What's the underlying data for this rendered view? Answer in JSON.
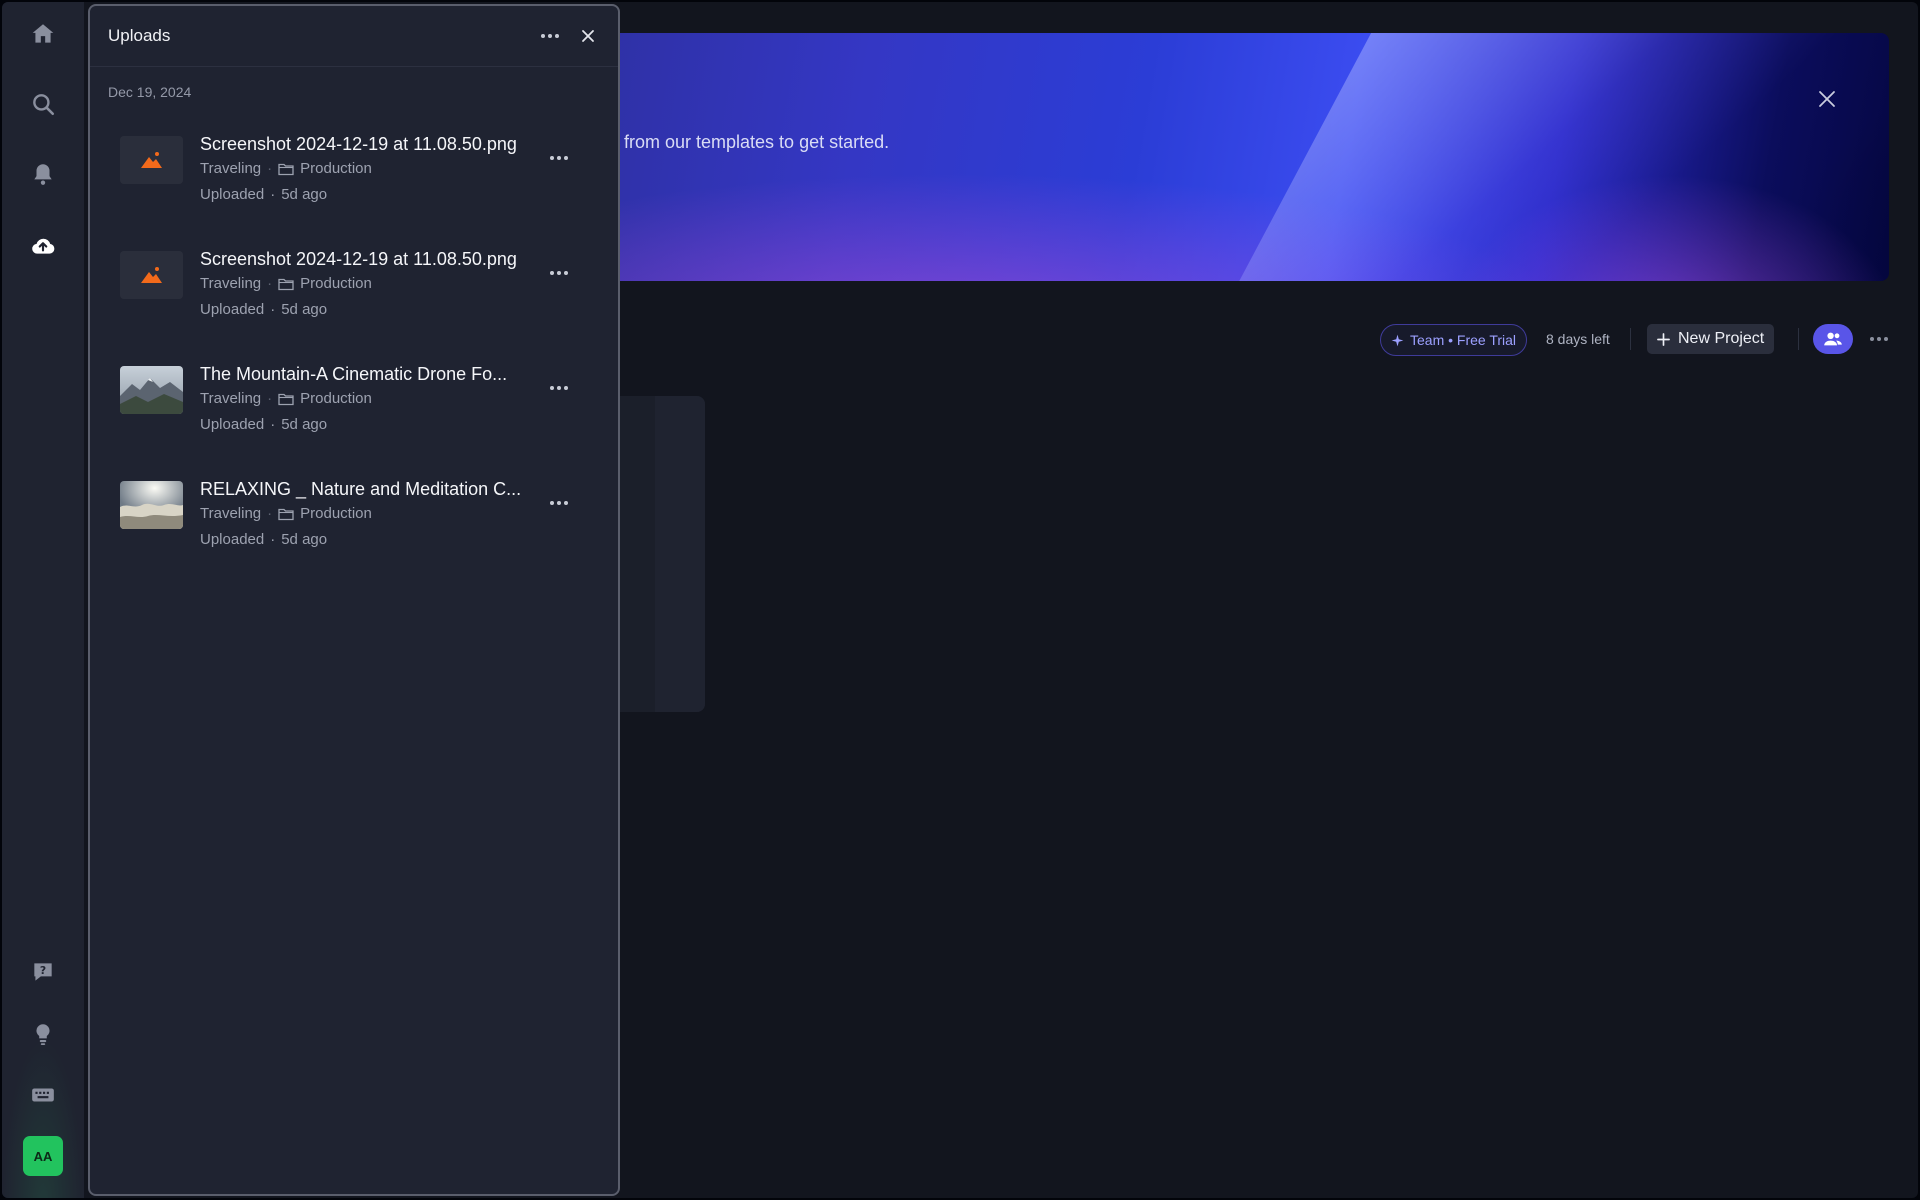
{
  "rail": {
    "items": [
      {
        "name": "home",
        "icon": "home-icon"
      },
      {
        "name": "search",
        "icon": "search-icon"
      },
      {
        "name": "notifications",
        "icon": "bell-icon"
      },
      {
        "name": "uploads",
        "icon": "cloud-upload-icon"
      },
      {
        "name": "help",
        "icon": "question-icon"
      },
      {
        "name": "ideas",
        "icon": "lightbulb-icon"
      },
      {
        "name": "shortcuts",
        "icon": "keyboard-icon"
      }
    ],
    "avatar_initials": "AA",
    "avatar_color": "#22c35e"
  },
  "banner": {
    "text": "from our templates to get started."
  },
  "toolbar": {
    "plan_label": "Team • Free Trial",
    "days_left": "8 days left",
    "new_project_label": "New Project",
    "accent_color": "#5955e8"
  },
  "uploads_panel": {
    "title": "Uploads",
    "date_group": "Dec 19, 2024",
    "items": [
      {
        "title": "Screenshot 2024-12-19 at 11.08.50.png",
        "project": "Traveling",
        "folder": "Production",
        "status": "Uploaded",
        "age": "5d ago",
        "thumb": "image-placeholder-icon"
      },
      {
        "title": "Screenshot 2024-12-19 at 11.08.50.png",
        "project": "Traveling",
        "folder": "Production",
        "status": "Uploaded",
        "age": "5d ago",
        "thumb": "image-placeholder-icon"
      },
      {
        "title": "The Mountain-A Cinematic Drone Fo...",
        "project": "Traveling",
        "folder": "Production",
        "status": "Uploaded",
        "age": "5d ago",
        "thumb": "mountain-thumbnail"
      },
      {
        "title": "RELAXING _ Nature and Meditation C...",
        "project": "Traveling",
        "folder": "Production",
        "status": "Uploaded",
        "age": "5d ago",
        "thumb": "clouds-thumbnail"
      }
    ]
  }
}
